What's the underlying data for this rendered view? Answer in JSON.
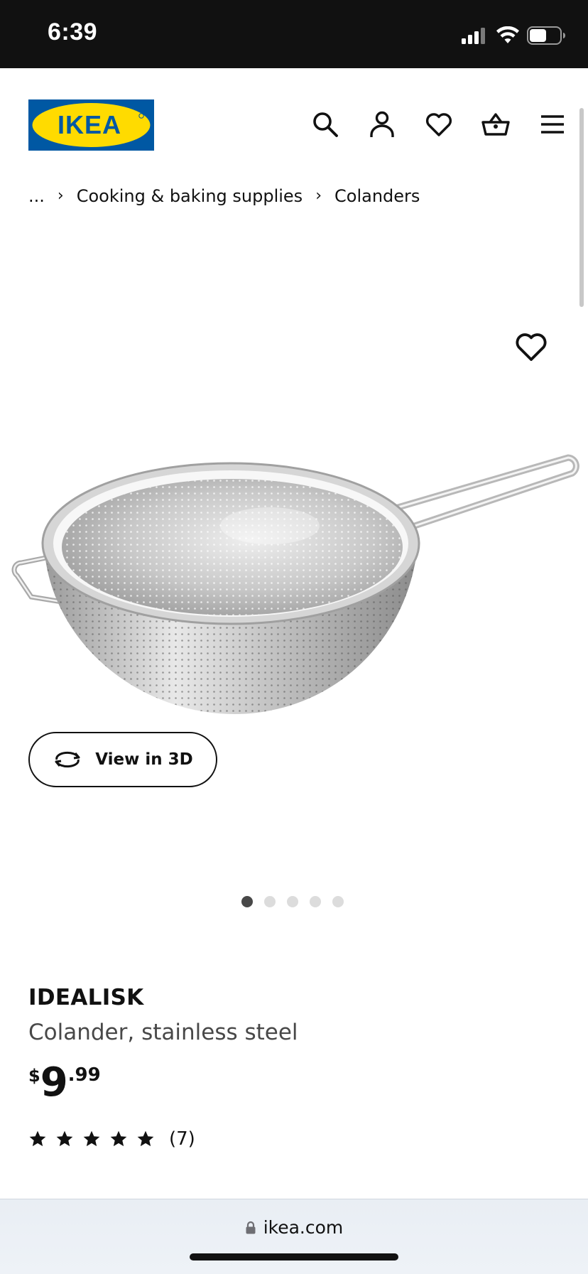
{
  "status_bar": {
    "time": "6:39",
    "battery_level": 0.55
  },
  "header": {
    "logo_text": "IKEA",
    "icons": [
      "search-icon",
      "account-icon",
      "wishlist-icon",
      "basket-icon",
      "menu-icon"
    ]
  },
  "breadcrumb": {
    "items": [
      "...",
      "Cooking & baking supplies",
      "Colanders"
    ],
    "separator": "›"
  },
  "product": {
    "view3d_label": "View in 3D",
    "image_count": 5,
    "active_image": 1,
    "name": "IDEALISK",
    "description": "Colander, stainless steel",
    "price": {
      "currency": "$",
      "integer": "9",
      "decimal": ".99"
    },
    "rating": {
      "stars": 5,
      "count": "(7)"
    }
  },
  "browser": {
    "url": "ikea.com"
  },
  "colors": {
    "ikea_blue": "#0058a3",
    "ikea_yellow": "#ffdb00",
    "text": "#111111",
    "muted": "#484848"
  }
}
